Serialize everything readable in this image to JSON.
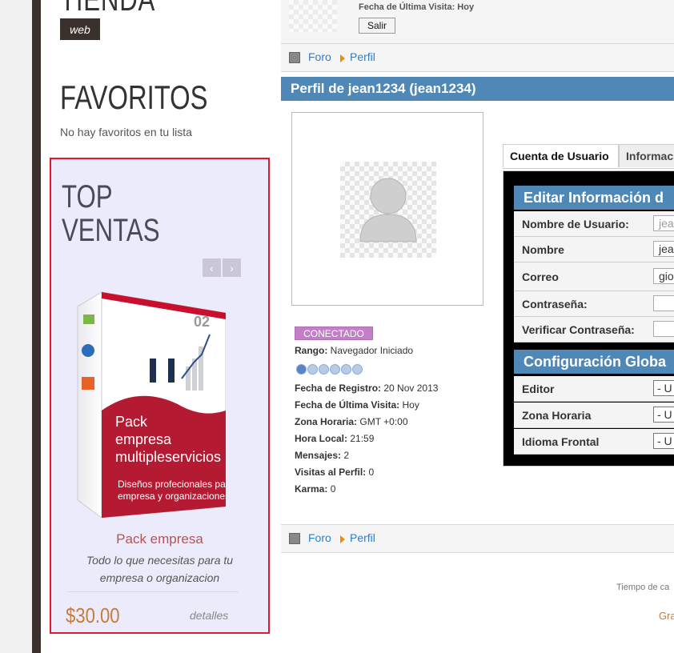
{
  "store": {
    "title": "TIENDA",
    "tag": "web"
  },
  "favorites": {
    "title": "FAVORITOS",
    "empty_text": "No hay favoritos en tu lista"
  },
  "top_sales": {
    "title_line1": "TOP",
    "title_line2": "VENTAS",
    "prev_icon": "chevron-left-icon",
    "next_icon": "chevron-right-icon",
    "product": {
      "box_number": "02",
      "box_title_1": "Pack",
      "box_title_2": "empresa",
      "box_title_3": "multipleservicios",
      "box_sub_1": "Diseños profecionales para",
      "box_sub_2": "empresa y organizaciones",
      "name": "Pack empresa",
      "desc_1": "Todo lo que necesitas para tu",
      "desc_2": "empresa o organizacion",
      "price": "$30.00",
      "details": "detalles"
    }
  },
  "user_header": {
    "last_visit": "Fecha de Última Visita: Hoy",
    "logout": "Salir"
  },
  "breadcrumb": {
    "home": "Foro",
    "current": "Perfil"
  },
  "profile": {
    "title": "Perfil de jean1234 (jean1234)",
    "status": "CONECTADO",
    "rank_label": "Rango:",
    "rank_value": "Navegador Iniciado",
    "rank_level": 1,
    "rank_max": 6,
    "fields": [
      {
        "label": "Fecha de Registro:",
        "value": "20 Nov 2013"
      },
      {
        "label": "Fecha de Última Visita:",
        "value": "Hoy"
      },
      {
        "label": "Zona Horaria:",
        "value": "GMT +0:00"
      },
      {
        "label": "Hora Local:",
        "value": "21:59"
      },
      {
        "label": "Mensajes:",
        "value": "2"
      },
      {
        "label": "Visitas al Perfil:",
        "value": "0"
      },
      {
        "label": "Karma:",
        "value": "0"
      }
    ]
  },
  "tabs": {
    "active": "Cuenta de Usuario",
    "other": "Informaci"
  },
  "edit_section": {
    "title": "Editar Información d",
    "rows": [
      {
        "label": "Nombre de Usuario:",
        "value": "jea",
        "placeholder": true
      },
      {
        "label": "Nombre",
        "value": "jea",
        "placeholder": false
      },
      {
        "label": "Correo",
        "value": "gio",
        "placeholder": false
      },
      {
        "label": "Contraseña:",
        "value": "",
        "placeholder": false
      },
      {
        "label": "Verificar Contraseña:",
        "value": "",
        "placeholder": false
      }
    ]
  },
  "global_section": {
    "title": "Configuración Globa",
    "rows": [
      {
        "label": "Editor",
        "value": "- U"
      },
      {
        "label": "Zona Horaria",
        "value": "- U"
      },
      {
        "label": "Idioma Frontal",
        "value": "- U"
      }
    ]
  },
  "footer": {
    "time_text": "Tiempo de ca",
    "link_text": "Gra"
  },
  "colors": {
    "accent_blue": "#4f87b6",
    "sale_border": "#e0192d",
    "price": "#c77b3a",
    "online": "#c27fc8"
  }
}
